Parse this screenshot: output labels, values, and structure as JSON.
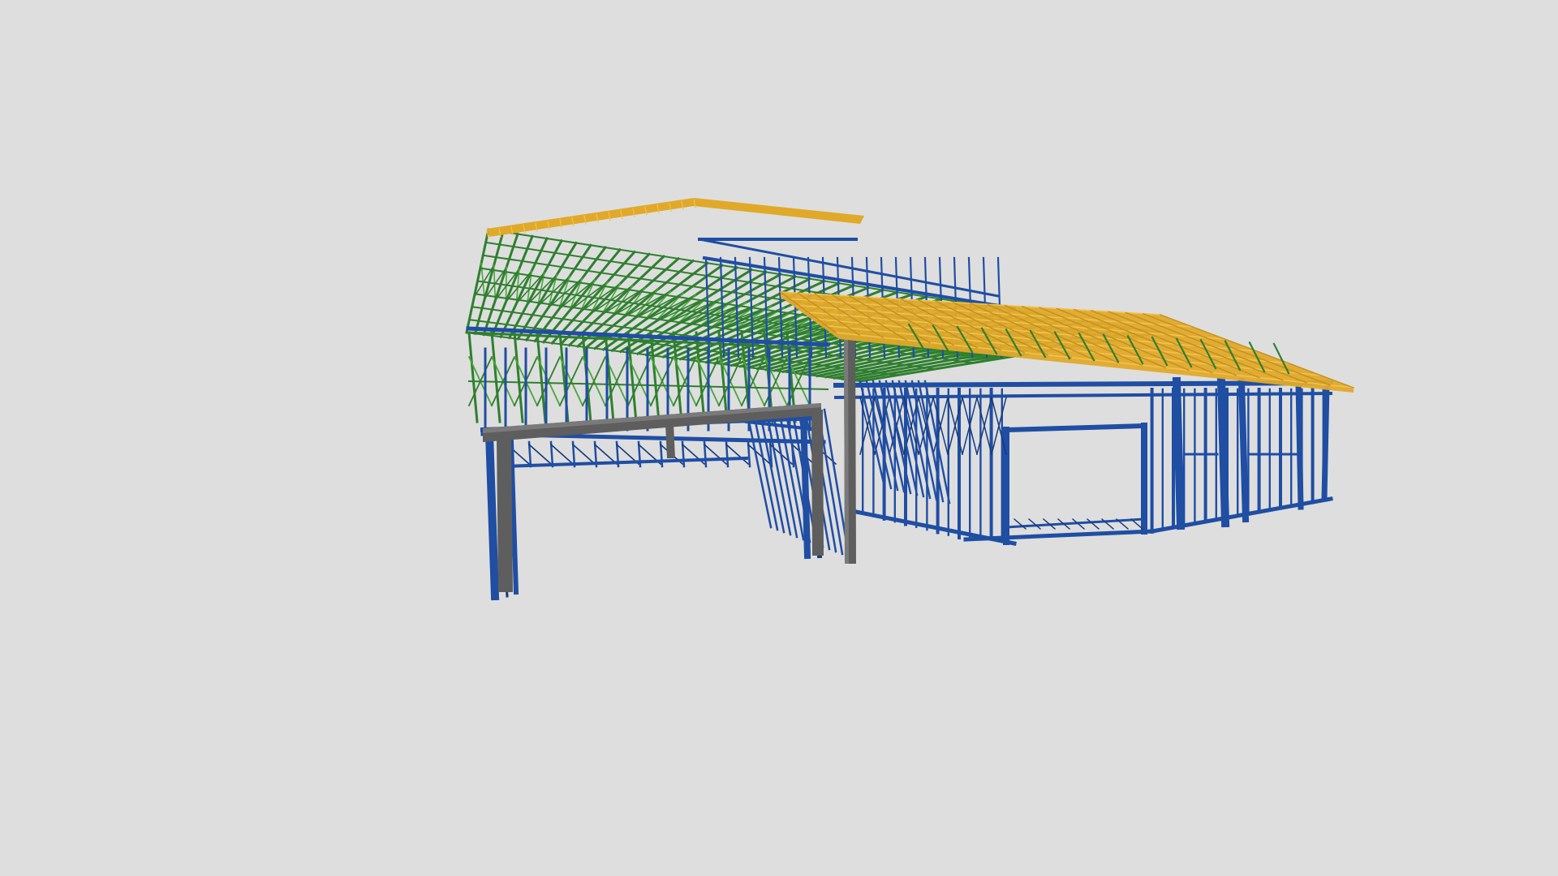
{
  "viewer": {
    "background": "#dedede"
  },
  "model": {
    "colors": {
      "wall_frames": "#1f4ea3",
      "wall_frames_dark": "#163a7e",
      "roof_trusses": "#2f7f2f",
      "roof_trusses_light": "#4aa83c",
      "roof_battens": "#e0a92a",
      "roof_battens_light": "#f2c24a",
      "steel_beams": "#5e5e5e",
      "steel_beams_light": "#7a7a7a"
    }
  }
}
